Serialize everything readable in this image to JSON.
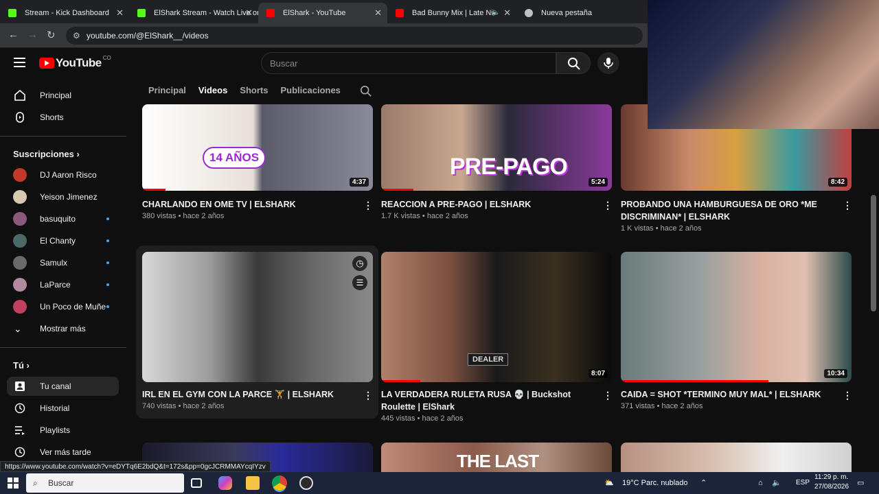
{
  "browser": {
    "tabs": [
      {
        "title": "Stream - Kick Dashboard",
        "icon": "kick-icon",
        "color": "#53fc18"
      },
      {
        "title": "ElShark Stream - Watch Live on Kick",
        "icon": "kick-icon",
        "color": "#53fc18"
      },
      {
        "title": "ElShark - YouTube",
        "icon": "youtube-icon",
        "color": "#ff0000",
        "active": true
      },
      {
        "title": "Bad Bunny Mix | Late Night",
        "icon": "youtube-icon",
        "color": "#ff0000"
      },
      {
        "title": "Nueva pestaña",
        "icon": "chrome-icon",
        "color": "#bdc1c6"
      }
    ],
    "url": "youtube.com/@ElShark__/videos",
    "status_url": "https://www.youtube.com/watch?v=eDYTq6E2bdQ&t=172s&pp=0gcJCRMMAYcqIYzv"
  },
  "header": {
    "logo_text": "YouTube",
    "country": "CO",
    "search_placeholder": "Buscar"
  },
  "channel_tabs": [
    "Principal",
    "Videos",
    "Shorts",
    "Publicaciones"
  ],
  "active_tab": "Videos",
  "sidebar": {
    "top": [
      {
        "label": "Principal",
        "icon": "home-icon"
      },
      {
        "label": "Shorts",
        "icon": "shorts-icon"
      }
    ],
    "subs_heading": "Suscripciones",
    "subs": [
      {
        "label": "DJ Aaron Risco",
        "color": "#c0392b",
        "dot": false
      },
      {
        "label": "Yeison Jimenez",
        "color": "#d8c8b0",
        "dot": false
      },
      {
        "label": "basuquito",
        "color": "#8a5a7a",
        "dot": true
      },
      {
        "label": "El Chanty",
        "color": "#4a6a6a",
        "dot": true
      },
      {
        "label": "Samulx",
        "color": "#6a6a6a",
        "dot": true
      },
      {
        "label": "LaParce",
        "color": "#b08aa0",
        "dot": true
      },
      {
        "label": "Un Poco de Muñe",
        "color": "#c04060",
        "dot": true
      }
    ],
    "show_more": "Mostrar más",
    "you_heading": "Tú",
    "you": [
      {
        "label": "Tu canal",
        "icon": "account-icon",
        "active": true
      },
      {
        "label": "Historial",
        "icon": "history-icon"
      },
      {
        "label": "Playlists",
        "icon": "playlist-icon"
      },
      {
        "label": "Ver más tarde",
        "icon": "clock-icon"
      }
    ]
  },
  "videos": [
    {
      "title": "CHARLANDO EN OME TV | ELSHARK",
      "meta": "380 vistas • hace 2 años",
      "duration": "4:37",
      "thumb_text": "14 AÑOS",
      "progress": 0.1
    },
    {
      "title": "REACCION A PRE-PAGO | ELSHARK",
      "meta": "1.7 K vistas • hace 2 años",
      "duration": "5:24",
      "thumb_text": "PRE-PAGO",
      "progress": 0.14
    },
    {
      "title": "PROBANDO UNA HAMBURGUESA DE ORO  *ME DISCRIMINAN* | ELSHARK",
      "meta": "1 K vistas • hace 2 años",
      "duration": "8:42",
      "thumb_text": "",
      "progress": 0
    },
    {
      "title": "IRL EN EL GYM CON LA PARCE 🏋️ | ELSHARK",
      "meta": "740 vistas • hace 2 años",
      "duration": "",
      "thumb_text": "",
      "progress": 0
    },
    {
      "title": "LA VERDADERA RULETA RUSA 💀 | Buckshot Roulette | ElShark",
      "meta": "445 vistas • hace 2 años",
      "duration": "8:07",
      "thumb_text": "DEALER",
      "progress": 0.17
    },
    {
      "title": "CAIDA = SHOT *TERMINO MUY MAL* | ELSHARK",
      "meta": "371 vistas • hace 2 años",
      "duration": "10:34",
      "thumb_text": "",
      "progress": 0.64
    }
  ],
  "row3_text": "THE LAST",
  "taskbar": {
    "search": "Buscar",
    "weather": "19°C  Parc. nublado",
    "lang": "ESP",
    "time": "11:29 p. m.",
    "date": "27/08/2026"
  }
}
